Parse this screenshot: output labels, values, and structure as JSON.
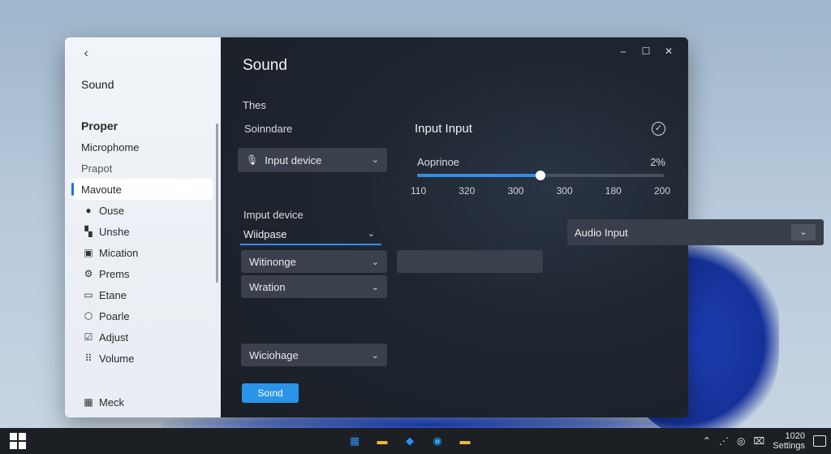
{
  "window": {
    "controls": {
      "minimize": "–",
      "maximize": "☐",
      "close": "✕"
    }
  },
  "sidebar": {
    "back_icon": "‹",
    "title": "Sound",
    "items": [
      {
        "label": "Proper",
        "icon": "",
        "style": "bold"
      },
      {
        "label": "Microphome",
        "icon": ""
      },
      {
        "label": "Prapot",
        "icon": "",
        "style": "muted"
      },
      {
        "label": "Mavoute",
        "icon": "",
        "active": true
      },
      {
        "label": "Ouse",
        "icon": "mic-icon"
      },
      {
        "label": "Unshe",
        "icon": "apps-icon"
      },
      {
        "label": "Mication",
        "icon": "display-icon"
      },
      {
        "label": "Prems",
        "icon": "gear-icon"
      },
      {
        "label": "Etane",
        "icon": "keyboard-icon"
      },
      {
        "label": "Poarle",
        "icon": "shield-icon"
      },
      {
        "label": "Adjust",
        "icon": "check-icon"
      },
      {
        "label": "Volume",
        "icon": "grid-icon"
      }
    ],
    "bottom_item": {
      "label": "Meck",
      "icon": "windows-icon"
    }
  },
  "main": {
    "title": "Sound",
    "subtitle": "Thes",
    "left": {
      "section_label": "Soinndare",
      "input_device_dropdown": "Input device",
      "input_device_label": "Imput device",
      "field_value": "Wiidpase",
      "dropdown_1": "Witinonge",
      "dropdown_2": "Wration",
      "dropdown_3": "Wiciohage",
      "sound_button": "Soınd"
    },
    "right": {
      "section_title": "Input Input",
      "slider_label": "Aoprinoe",
      "slider_value_text": "2%",
      "slider_level": 0.5,
      "ticks": [
        "110",
        "320",
        "300",
        "300",
        "180",
        "200"
      ],
      "audio_input": "Audio Input"
    }
  },
  "taskbar": {
    "apps": [
      {
        "name": "windows-store-icon",
        "glyph": "▦",
        "color": "#2f8fea"
      },
      {
        "name": "folder-icon",
        "glyph": "▬",
        "color": "#f3b93a"
      },
      {
        "name": "cube-icon",
        "glyph": "◆",
        "color": "#2f8fea"
      },
      {
        "name": "edge-icon",
        "glyph": "◉",
        "color": "#2aa3f0"
      },
      {
        "name": "files-icon",
        "glyph": "▬",
        "color": "#f3b93a"
      }
    ],
    "clock_time": "1020",
    "clock_label": "Settings"
  }
}
